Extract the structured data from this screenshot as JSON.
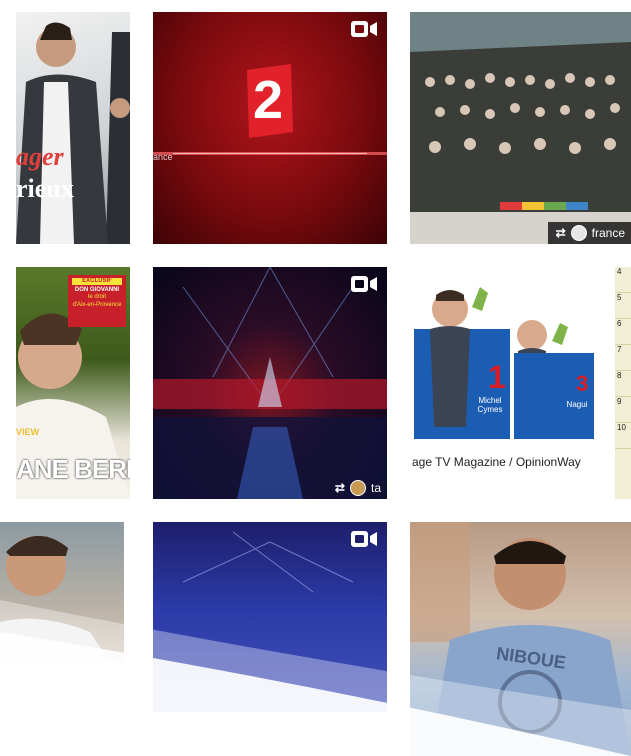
{
  "tiles": [
    {
      "id": "t1",
      "overlay_lines": [
        "ager",
        "rieux"
      ],
      "video": false
    },
    {
      "id": "t2",
      "logo_digit": "2",
      "overlay_small": "ance",
      "video": true
    },
    {
      "id": "t3",
      "video": false,
      "repost_handle": "france"
    },
    {
      "id": "t4",
      "badge_top": "EXCLUSIF",
      "badge_lines": [
        "DON GIOVANNI",
        "le droit",
        "d'Aix-en-Provence"
      ],
      "name_text": "ANE BERN",
      "corner_text": "VIEW",
      "video": false
    },
    {
      "id": "t5",
      "video": true,
      "repost_handle": "ta"
    },
    {
      "id": "t6",
      "caption": "age TV Magazine / OpinionWay",
      "ranks": [
        {
          "rank": "1",
          "name": "Michel\nCymes"
        },
        {
          "rank": "3",
          "name": "Nagui"
        }
      ],
      "side_ranks": [
        "4",
        "5",
        "6",
        "7",
        "8",
        "9",
        "10"
      ],
      "video": false
    },
    {
      "id": "t7",
      "video": false
    },
    {
      "id": "t8",
      "video": true
    },
    {
      "id": "t9",
      "shirt_text": "NIBOUE",
      "video": false
    }
  ],
  "colors": {
    "france2_red": "#b0151b",
    "rank_blue": "#1c5db4",
    "rank_red": "#d81f26"
  }
}
